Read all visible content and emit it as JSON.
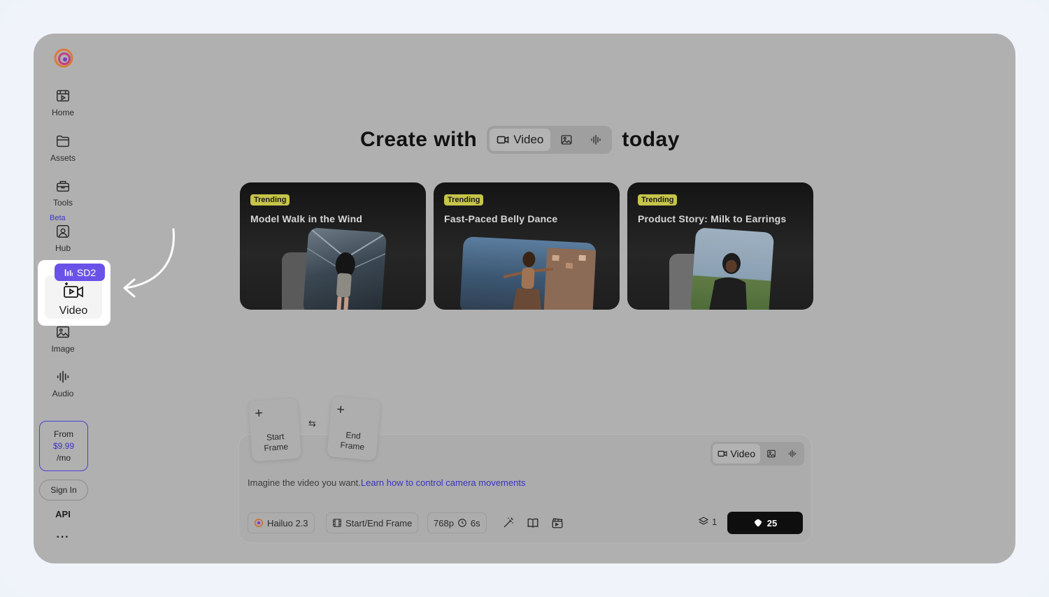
{
  "sidebar": {
    "logo": "hailuo-logo-icon",
    "items": [
      {
        "label": "Home",
        "icon": "home-icon"
      },
      {
        "label": "Assets",
        "icon": "folder-icon"
      },
      {
        "label": "Tools",
        "icon": "toolbox-icon"
      },
      {
        "label": "Hub",
        "icon": "hub-icon",
        "badge": "Beta"
      },
      {
        "label": "Video",
        "icon": "video-icon",
        "badge": "SD2",
        "highlighted": true
      },
      {
        "label": "Image",
        "icon": "image-icon"
      },
      {
        "label": "Audio",
        "icon": "audio-icon"
      }
    ],
    "pricing": {
      "line1": "From",
      "price": "$9.99",
      "line3": "/mo"
    },
    "sign_in": "Sign In",
    "api": "API",
    "more": "···"
  },
  "headline": {
    "prefix": "Create with",
    "suffix": "today",
    "modes": [
      {
        "label": "Video",
        "icon": "video-camera-icon",
        "active": true
      },
      {
        "label": "",
        "icon": "image-icon",
        "active": false
      },
      {
        "label": "",
        "icon": "audio-wave-icon",
        "active": false
      }
    ]
  },
  "cards": [
    {
      "tag": "Trending",
      "title": "Model Walk in the Wind"
    },
    {
      "tag": "Trending",
      "title": "Fast-Paced Belly Dance"
    },
    {
      "tag": "Trending",
      "title": "Product Story: Milk to Earrings"
    }
  ],
  "composer": {
    "start_frame": {
      "plus": "+",
      "label": "Start\nFrame"
    },
    "end_frame": {
      "plus": "+",
      "label": "End\nFrame"
    },
    "swap": "⇆",
    "prompt_placeholder": "Imagine the video you want.",
    "prompt_link": "Learn how to control camera movements",
    "mode_video": "Video",
    "model": "Hailuo 2.3",
    "frame_mode": "Start/End Frame",
    "resolution": "768p",
    "duration": "6s",
    "count": "1",
    "credits": "25"
  },
  "colors": {
    "accent": "#6a52e8",
    "link": "#3a32c0",
    "tag": "#c6c44a",
    "overlay": "#b0b0b0"
  }
}
